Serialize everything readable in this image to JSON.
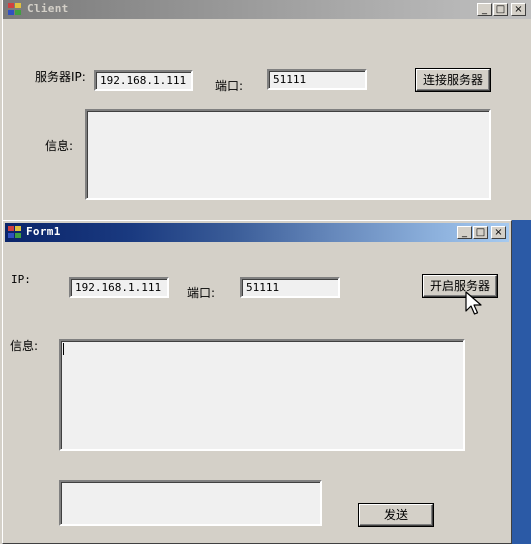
{
  "client_window": {
    "title": "Client",
    "server_ip_label": "服务器IP:",
    "server_ip_value": "192.168.1.111",
    "port_label": "端口:",
    "port_value": "51111",
    "connect_button": "连接服务器",
    "info_label": "信息:"
  },
  "form1_window": {
    "title": "Form1",
    "ip_label": "IP:",
    "ip_value": "192.168.1.111",
    "port_label": "端口:",
    "port_value": "51111",
    "start_button": "开启服务器",
    "info_label": "信息:",
    "send_button": "发送"
  },
  "controls": {
    "minimize": "_",
    "maximize": "□",
    "close": "×"
  },
  "colors": {
    "client_titlebar_inactive": "#8a8a8a",
    "form1_titlebar_active": "#0a246a",
    "form1_titlebar_gradient_end": "#a6caf0",
    "face": "#d4d0c8",
    "desktop": "#2b5aa6"
  }
}
